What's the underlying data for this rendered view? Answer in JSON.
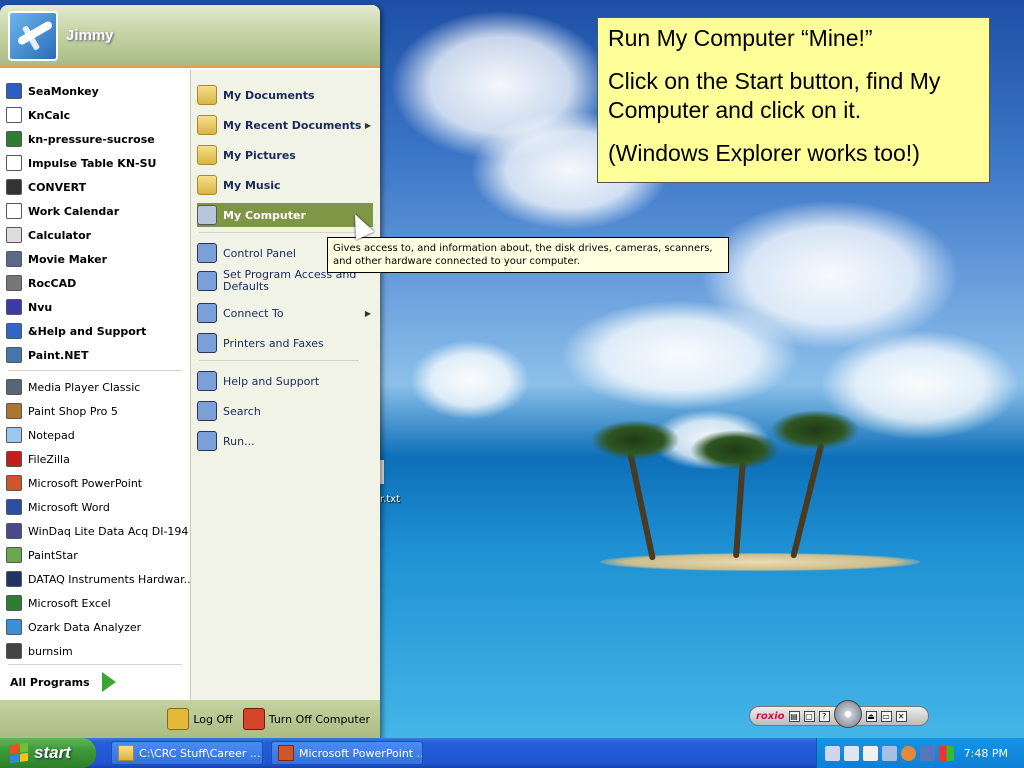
{
  "start_menu": {
    "username": "Jimmy",
    "pinned": [
      {
        "label": "SeaMonkey",
        "icon": "seamonkey-icon",
        "color": "#2c5fc4"
      },
      {
        "label": "KnCalc",
        "icon": "kncalc-icon",
        "color": "#ffffff"
      },
      {
        "label": "kn-pressure-sucrose",
        "icon": "spreadsheet-icon",
        "color": "#2e7d32"
      },
      {
        "label": "Impulse Table KN-SU",
        "icon": "document-icon",
        "color": "#ffffff"
      },
      {
        "label": "CONVERT",
        "icon": "convert-icon",
        "color": "#333333"
      },
      {
        "label": "Work Calendar",
        "icon": "calendar-icon",
        "color": "#ffffff"
      },
      {
        "label": "Calculator",
        "icon": "calculator-icon",
        "color": "#dddddd"
      },
      {
        "label": "Movie Maker",
        "icon": "movie-maker-icon",
        "color": "#5b6a8a"
      },
      {
        "label": "RocCAD",
        "icon": "roccad-icon",
        "color": "#777777"
      },
      {
        "label": "Nvu",
        "icon": "nvu-icon",
        "color": "#3b3ba8"
      },
      {
        "label": "&Help and Support",
        "icon": "help-icon",
        "color": "#2f66c8"
      },
      {
        "label": "Paint.NET",
        "icon": "paintnet-icon",
        "color": "#4477aa"
      }
    ],
    "recent": [
      {
        "label": "Media Player Classic",
        "icon": "media-player-icon",
        "color": "#556677"
      },
      {
        "label": "Paint Shop Pro 5",
        "icon": "paint-shop-icon",
        "color": "#aa7733"
      },
      {
        "label": "Notepad",
        "icon": "notepad-icon",
        "color": "#9ec7ef"
      },
      {
        "label": "FileZilla",
        "icon": "filezilla-icon",
        "color": "#c41e1e"
      },
      {
        "label": "Microsoft PowerPoint",
        "icon": "powerpoint-icon",
        "color": "#d0542c"
      },
      {
        "label": "Microsoft Word",
        "icon": "word-icon",
        "color": "#2a4fa5"
      },
      {
        "label": "WinDaq Lite Data Acq DI-194",
        "icon": "windaq-icon",
        "color": "#4a4a8a"
      },
      {
        "label": "PaintStar",
        "icon": "paintstar-icon",
        "color": "#6aa84f"
      },
      {
        "label": "DATAQ Instruments Hardwar...",
        "icon": "dataq-icon",
        "color": "#223366"
      },
      {
        "label": "Microsoft Excel",
        "icon": "excel-icon",
        "color": "#2f7d32"
      },
      {
        "label": "Ozark Data Analyzer",
        "icon": "ozark-icon",
        "color": "#3a8fd8"
      },
      {
        "label": "burnsim",
        "icon": "burnsim-icon",
        "color": "#444444"
      }
    ],
    "all_programs": "All Programs",
    "right": [
      {
        "label": "My Documents",
        "icon": "my-documents-icon",
        "bold": true
      },
      {
        "label": "My Recent Documents",
        "icon": "recent-documents-icon",
        "bold": true,
        "arrow": "▶"
      },
      {
        "label": "My Pictures",
        "icon": "my-pictures-icon",
        "bold": true
      },
      {
        "label": "My Music",
        "icon": "my-music-icon",
        "bold": true
      },
      {
        "label": "My Computer",
        "icon": "my-computer-icon",
        "bold": true,
        "selected": true
      },
      {
        "label": "Control Panel",
        "icon": "control-panel-icon"
      },
      {
        "label": "Set Program Access and Defaults",
        "icon": "program-access-icon"
      },
      {
        "label": "Connect To",
        "icon": "connect-to-icon",
        "arrow": "▶"
      },
      {
        "label": "Printers and Faxes",
        "icon": "printer-icon"
      },
      {
        "label": "Help and Support",
        "icon": "help-support-icon"
      },
      {
        "label": "Search",
        "icon": "search-icon"
      },
      {
        "label": "Run...",
        "icon": "run-icon"
      }
    ],
    "logoff": "Log Off",
    "turnoff": "Turn Off Computer"
  },
  "tooltip": "Gives access to, and information about, the disk drives, cameras, scanners, and other hardware connected to your computer.",
  "note": {
    "line1": "Run My Computer “Mine!”",
    "line2": "Click on the Start button, find My Computer and click on it.",
    "line3": "(Windows Explorer works too!)"
  },
  "desktop_file": "r.txt",
  "roxio": {
    "logo": "roxio"
  },
  "taskbar": {
    "start": "start",
    "tasks": [
      {
        "label": "C:\\CRC Stuff\\Career ...",
        "icon": "folder-icon"
      },
      {
        "label": "Microsoft PowerPoint ...",
        "icon": "powerpoint-icon"
      }
    ],
    "clock": "7:48 PM"
  }
}
